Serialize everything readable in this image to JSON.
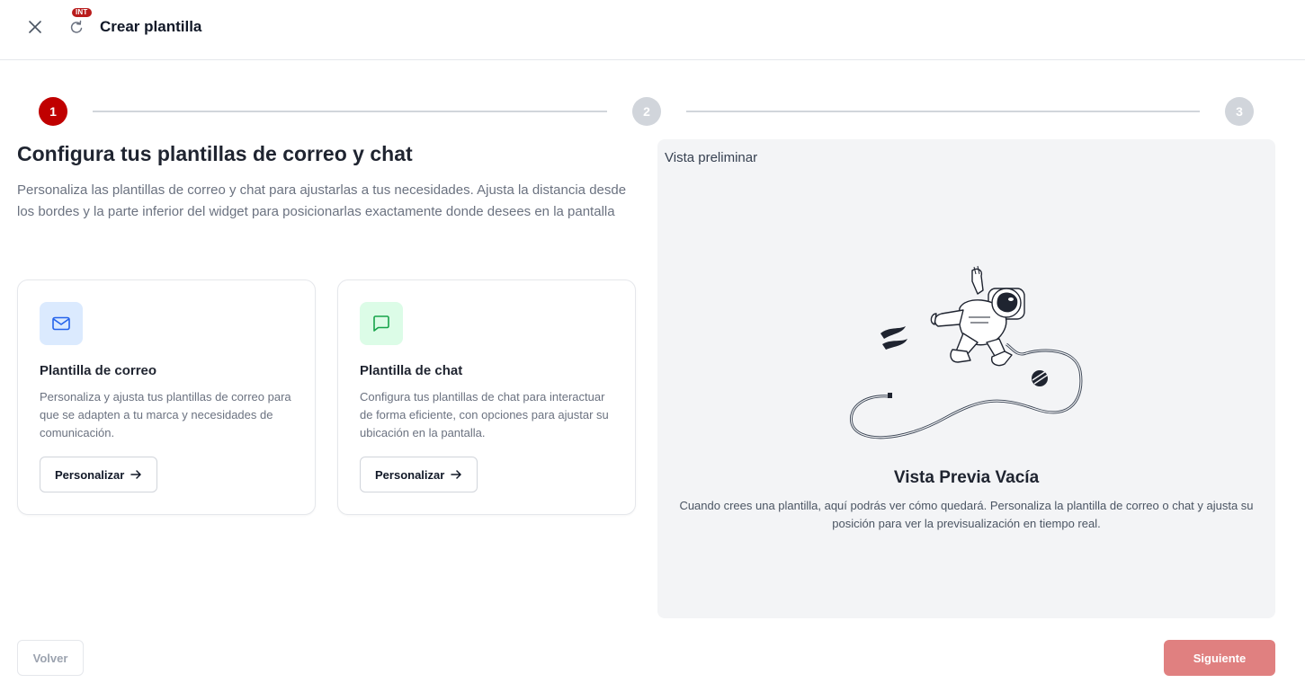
{
  "header": {
    "title": "Crear plantilla",
    "env_badge": "INT",
    "close_icon": "close-icon",
    "refresh_icon": "refresh-icon"
  },
  "stepper": {
    "steps": [
      "1",
      "2",
      "3"
    ],
    "current": 1,
    "active_color": "#c00000",
    "inactive_color": "#d1d5db"
  },
  "main": {
    "heading": "Configura tus plantillas de correo y chat",
    "description": "Personaliza las plantillas de correo y chat para ajustarlas a tus necesidades. Ajusta la distancia desde los bordes y la parte inferior del widget para posicionarlas exactamente donde desees en la pantalla",
    "cards": [
      {
        "icon": "mail-icon",
        "title": "Plantilla de correo",
        "text": "Personaliza y ajusta tus plantillas de correo para que se adapten a tu marca y necesidades de comunicación.",
        "button": "Personalizar"
      },
      {
        "icon": "chat-icon",
        "title": "Plantilla de chat",
        "text": "Configura tus plantillas de chat para interactuar de forma eficiente, con opciones para ajustar su ubicación en la pantalla.",
        "button": "Personalizar"
      }
    ]
  },
  "preview": {
    "label": "Vista preliminar",
    "illustration": "astronaut-illustration",
    "empty_title": "Vista Previa Vacía",
    "empty_text": "Cuando crees una plantilla, aquí podrás ver cómo quedará. Personaliza la plantilla de correo o chat y ajusta su posición para ver la previsualización en tiempo real."
  },
  "footer": {
    "back": "Volver",
    "next": "Siguiente",
    "next_color": "#e08080"
  }
}
